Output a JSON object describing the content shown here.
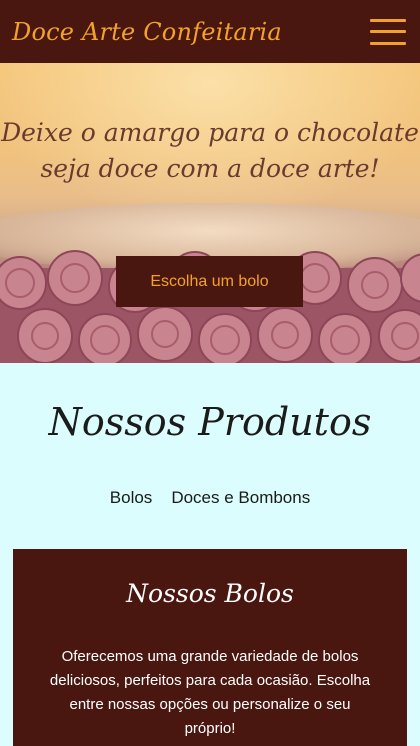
{
  "header": {
    "brand": "Doce Arte Confeitaria",
    "menu_icon": "hamburger-menu-icon"
  },
  "hero": {
    "line1": "Deixe o amargo para o chocolate",
    "line2": "seja doce com a doce arte!",
    "cta_label": "Escolha um bolo"
  },
  "products": {
    "title": "Nossos Produtos",
    "tabs": [
      {
        "label": "Bolos"
      },
      {
        "label": "Doces e Bombons"
      }
    ]
  },
  "card": {
    "title": "Nossos Bolos",
    "text": "Oferecemos uma grande variedade de bolos deliciosos, perfeitos para cada ocasião. Escolha entre nossas opções ou personalize o seu próprio!"
  },
  "colors": {
    "brown": "#4a1710",
    "gold": "#f2a22a",
    "mint_background": "#dcfdfd"
  }
}
